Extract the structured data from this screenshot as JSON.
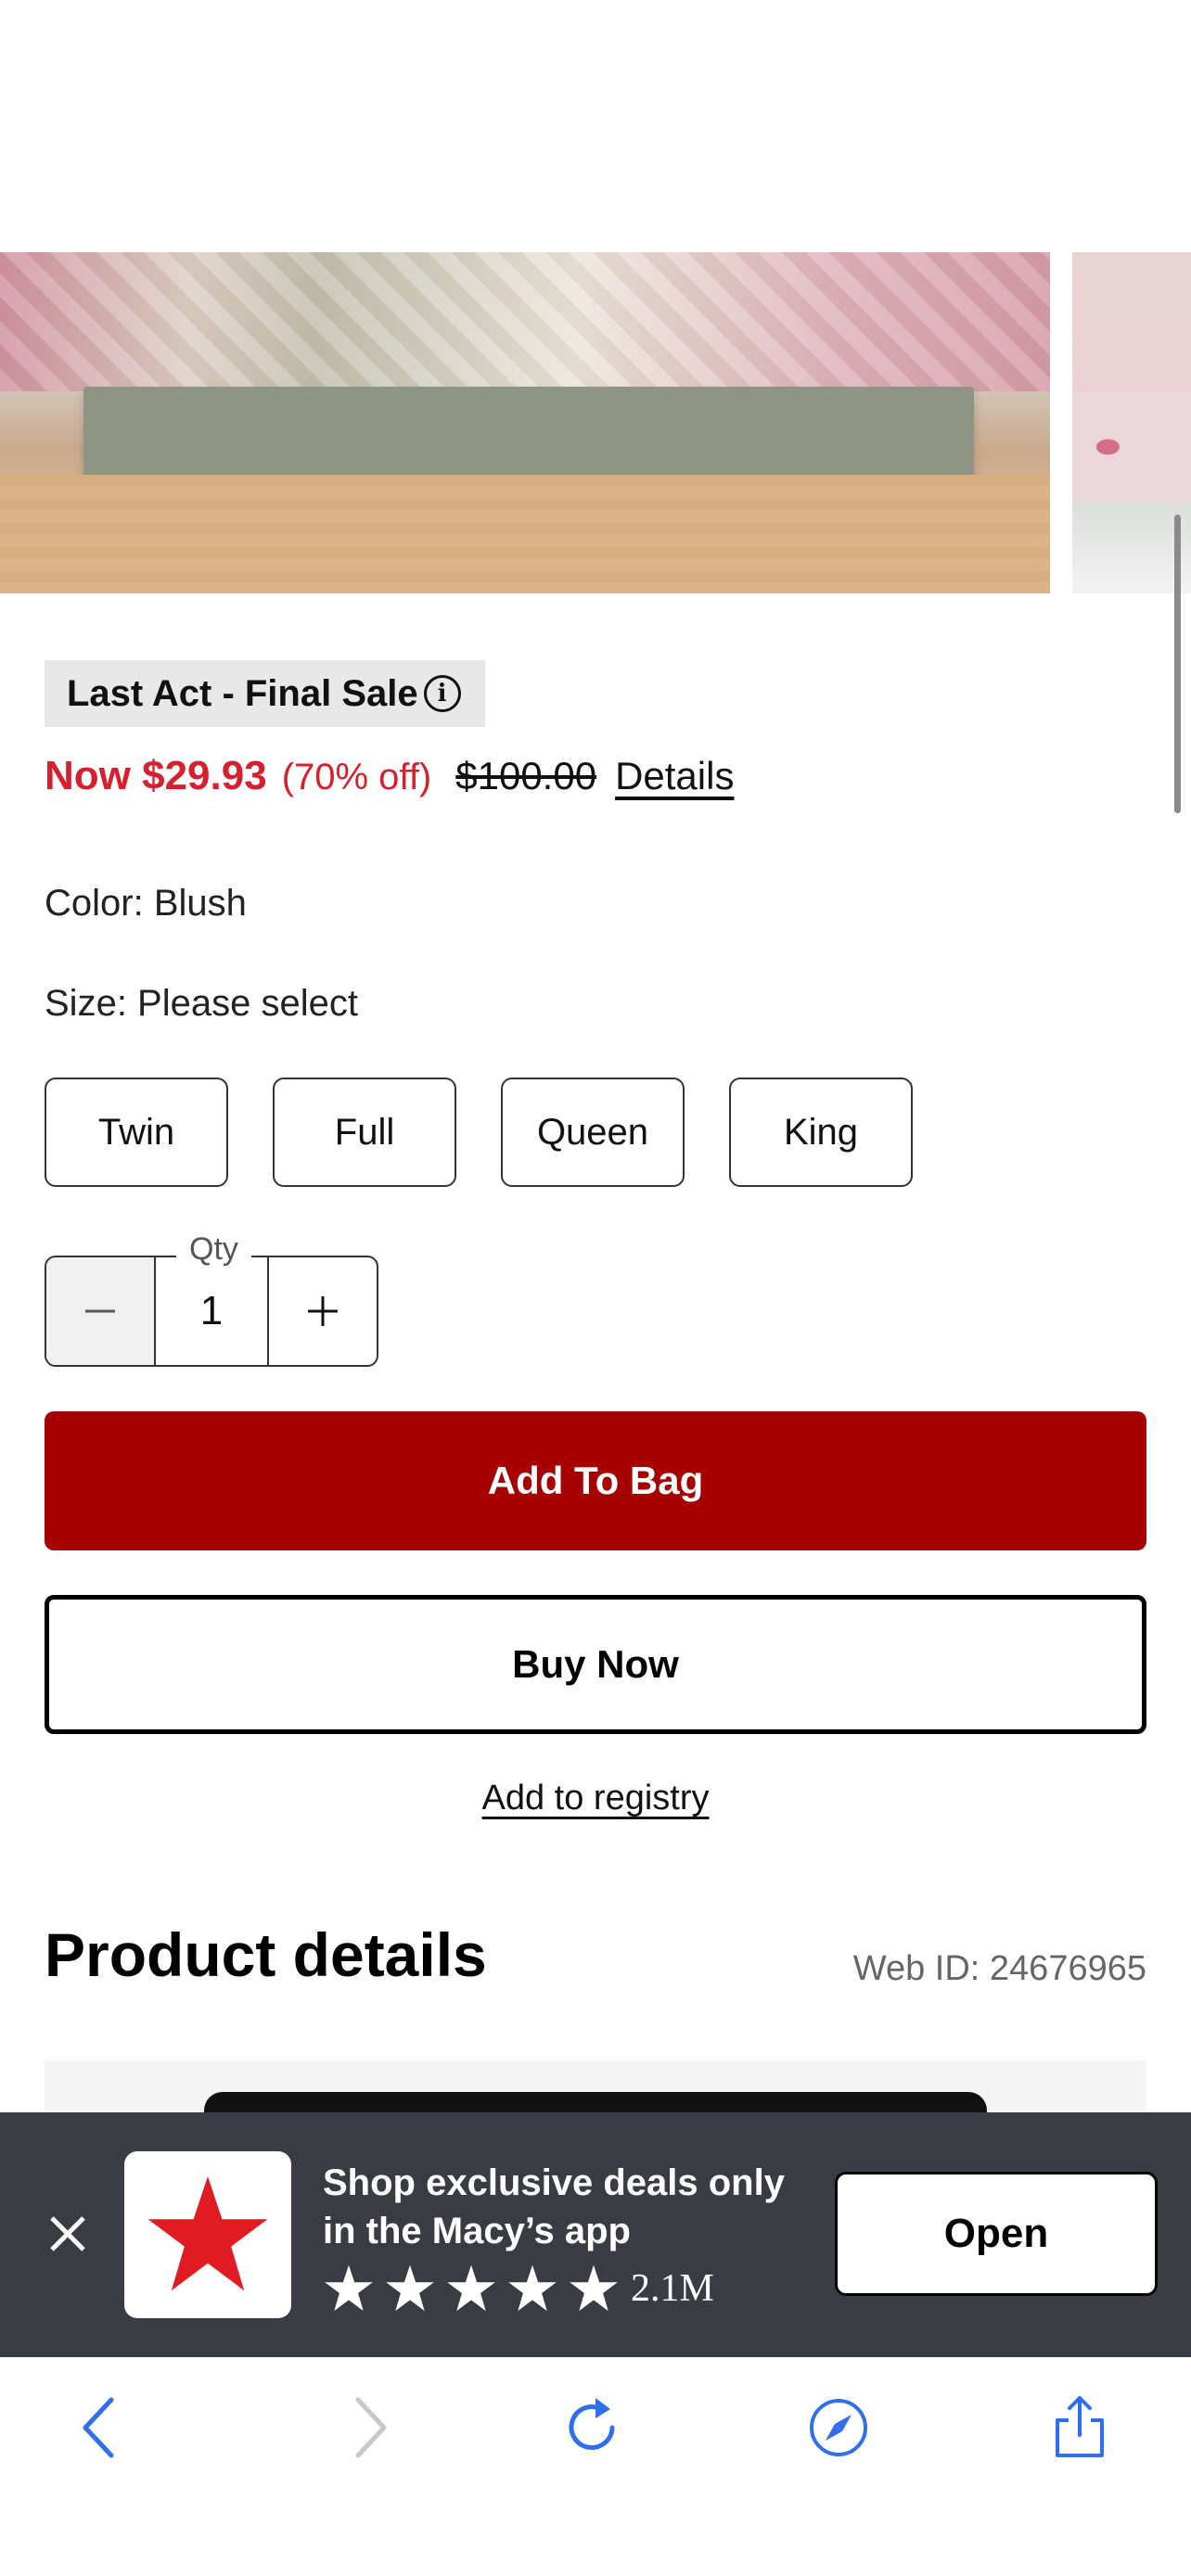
{
  "product": {
    "badge_text": "Last Act - Final Sale",
    "price_now": "Now $29.93",
    "price_off": "(70% off)",
    "price_original": "$100.00",
    "details_link": "Details",
    "color_line": "Color: Blush",
    "size_line": "Size: Please select",
    "sizes": [
      "Twin",
      "Full",
      "Queen",
      "King"
    ],
    "qty_label": "Qty",
    "qty_value": "1",
    "add_to_bag_label": "Add To Bag",
    "buy_now_label": "Buy Now",
    "registry_label": "Add to registry"
  },
  "details_section": {
    "title": "Product details",
    "web_id": "Web ID: 24676965"
  },
  "app_banner": {
    "message": "Shop exclusive deals only in the Macy’s app",
    "rating_count": "2.1M",
    "rating_stars": 5,
    "open_label": "Open"
  },
  "colors": {
    "sale_red": "#d6202f",
    "bag_button": "#a70000",
    "banner_bg": "#3a3c44",
    "macys_star": "#e11b22",
    "toolbar_blue": "#2f6fed"
  },
  "icons": {
    "badge": "info-icon",
    "banner_close": "close-icon",
    "toolbar": [
      "back-icon",
      "forward-icon",
      "reload-icon",
      "compass-icon",
      "share-icon"
    ]
  }
}
